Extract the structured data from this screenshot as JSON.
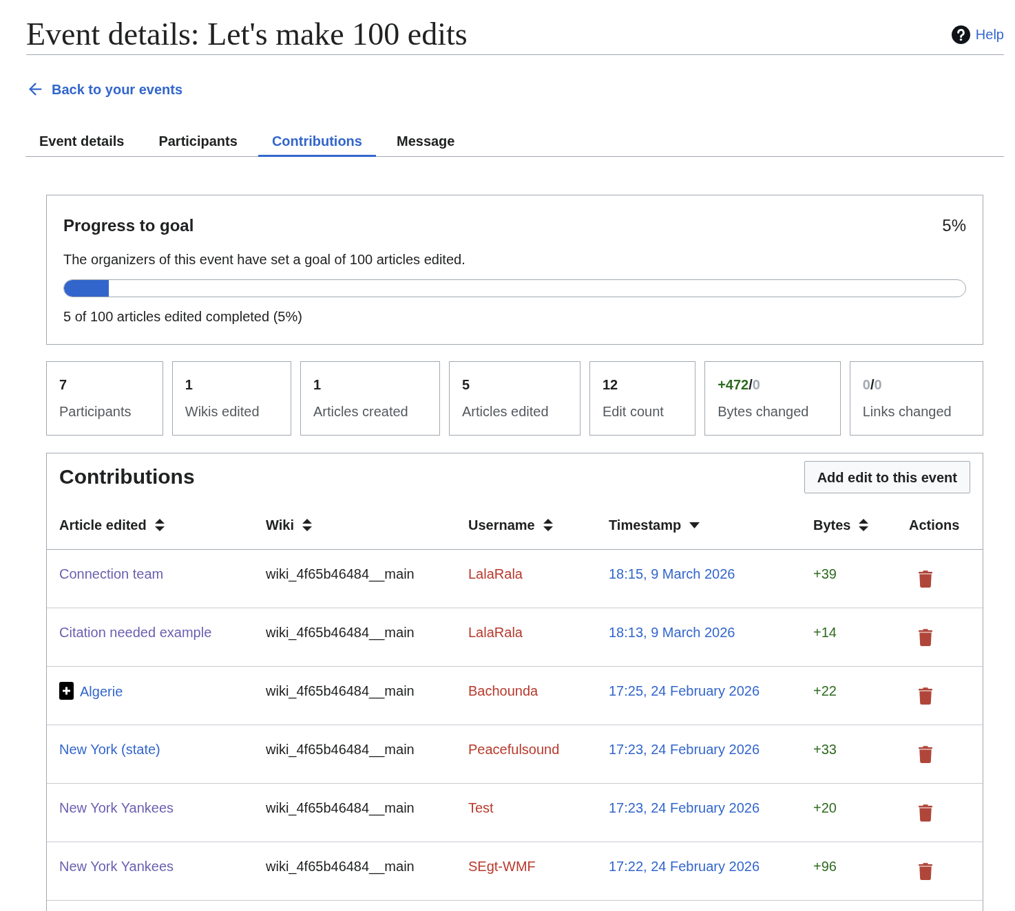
{
  "page": {
    "title": "Event details: Let's make 100 edits",
    "help": "Help"
  },
  "back_link": "Back to your events",
  "tabs": [
    {
      "label": "Event details",
      "selected": false
    },
    {
      "label": "Participants",
      "selected": false
    },
    {
      "label": "Contributions",
      "selected": true
    },
    {
      "label": "Message",
      "selected": false
    }
  ],
  "progress": {
    "title": "Progress to goal",
    "percent": "5%",
    "description": "The organizers of this event have set a goal of 100 articles edited.",
    "level": 0.05,
    "summary": "5 of 100 articles edited completed (5%)"
  },
  "stats": [
    {
      "value_parts": [
        {
          "text": "7",
          "kind": "plain"
        }
      ],
      "label": "Participants"
    },
    {
      "value_parts": [
        {
          "text": "1",
          "kind": "plain"
        }
      ],
      "label": "Wikis edited"
    },
    {
      "value_parts": [
        {
          "text": "1",
          "kind": "plain"
        }
      ],
      "label": "Articles created"
    },
    {
      "value_parts": [
        {
          "text": "5",
          "kind": "plain"
        }
      ],
      "label": "Articles edited"
    },
    {
      "value_parts": [
        {
          "text": "12",
          "kind": "plain"
        }
      ],
      "label": "Edit count"
    },
    {
      "value_parts": [
        {
          "text": "+472",
          "kind": "added"
        },
        {
          "text": "/",
          "kind": "plain"
        },
        {
          "text": "0",
          "kind": "zero"
        }
      ],
      "label": "Bytes changed"
    },
    {
      "value_parts": [
        {
          "text": "0",
          "kind": "zero"
        },
        {
          "text": "/",
          "kind": "plain"
        },
        {
          "text": "0",
          "kind": "zero"
        }
      ],
      "label": "Links changed"
    }
  ],
  "contributions": {
    "title": "Contributions",
    "add_button": "Add edit to this event",
    "columns": [
      {
        "label": "Article edited",
        "sortable": true,
        "sorted": false
      },
      {
        "label": "Wiki",
        "sortable": true,
        "sorted": false
      },
      {
        "label": "Username",
        "sortable": true,
        "sorted": false
      },
      {
        "label": "Timestamp",
        "sortable": true,
        "sorted": true
      },
      {
        "label": "Bytes",
        "sortable": true,
        "sorted": false
      },
      {
        "label": "Actions",
        "sortable": false
      }
    ],
    "rows": [
      {
        "article": "Connection team",
        "visited": true,
        "new_article": false,
        "wiki": "wiki_4f65b46484__main",
        "username": "LalaRala",
        "timestamp": "18:15, 9 March 2026",
        "bytes": "+39"
      },
      {
        "article": "Citation needed example",
        "visited": true,
        "new_article": false,
        "wiki": "wiki_4f65b46484__main",
        "username": "LalaRala",
        "timestamp": "18:13, 9 March 2026",
        "bytes": "+14"
      },
      {
        "article": "Algerie",
        "visited": false,
        "new_article": true,
        "wiki": "wiki_4f65b46484__main",
        "username": "Bachounda",
        "timestamp": "17:25, 24 February 2026",
        "bytes": "+22"
      },
      {
        "article": "New York (state)",
        "visited": false,
        "new_article": false,
        "wiki": "wiki_4f65b46484__main",
        "username": "Peacefulsound",
        "timestamp": "17:23, 24 February 2026",
        "bytes": "+33"
      },
      {
        "article": "New York Yankees",
        "visited": true,
        "new_article": false,
        "wiki": "wiki_4f65b46484__main",
        "username": "Test",
        "timestamp": "17:23, 24 February 2026",
        "bytes": "+20"
      },
      {
        "article": "New York Yankees",
        "visited": true,
        "new_article": false,
        "wiki": "wiki_4f65b46484__main",
        "username": "SEgt-WMF",
        "timestamp": "17:22, 24 February 2026",
        "bytes": "+96"
      }
    ]
  }
}
